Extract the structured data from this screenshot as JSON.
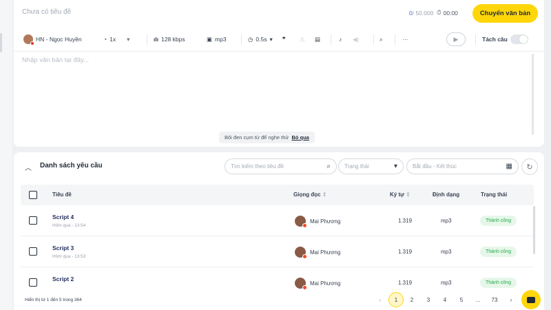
{
  "editor": {
    "title_placeholder": "Chưa có tiêu đề",
    "char_count": "0",
    "char_limit": "/ 50.000",
    "duration": "00:00",
    "convert_button": "Chuyển văn bản",
    "text_placeholder": "Nhập văn bản tại đây...",
    "hint_text": "Bôi đen cụm từ để nghe thử",
    "hint_skip": "Bỏ qua"
  },
  "toolbar": {
    "voice": "HN - Ngọc Huyền",
    "speed": "1x",
    "bitrate": "128 kbps",
    "format": "mp3",
    "pause": "0.5s",
    "split_label": "Tách câu"
  },
  "request_list": {
    "title": "Danh sách yêu cầu",
    "search_placeholder": "Tìm kiếm theo tiêu đề",
    "status_placeholder": "Trạng thái",
    "date_placeholder": "Bắt đầu - Kết thúc",
    "columns": {
      "title": "Tiêu đề",
      "voice": "Giọng đọc",
      "chars": "Ký tự",
      "format": "Định dạng",
      "status": "Trạng thái"
    },
    "rows": [
      {
        "title": "Script 4",
        "time": "Hôm qua - 13:54",
        "voice": "Mai Phương",
        "chars": "1.319",
        "format": "mp3",
        "status": "Thành công"
      },
      {
        "title": "Script 3",
        "time": "Hôm qua - 13:53",
        "voice": "Mai Phương",
        "chars": "1.319",
        "format": "mp3",
        "status": "Thành công"
      },
      {
        "title": "Script 2",
        "time": "",
        "voice": "Mai Phương",
        "chars": "1.319",
        "format": "mp3",
        "status": "Thành công"
      }
    ],
    "range_text": "Hiển thị từ 1 đến 5 trong 364",
    "pages": [
      "1",
      "2",
      "3",
      "4",
      "5",
      "...",
      "73"
    ]
  },
  "colors": {
    "accent": "#ffd60a",
    "success": "#22a849",
    "link": "#4b63d9"
  }
}
